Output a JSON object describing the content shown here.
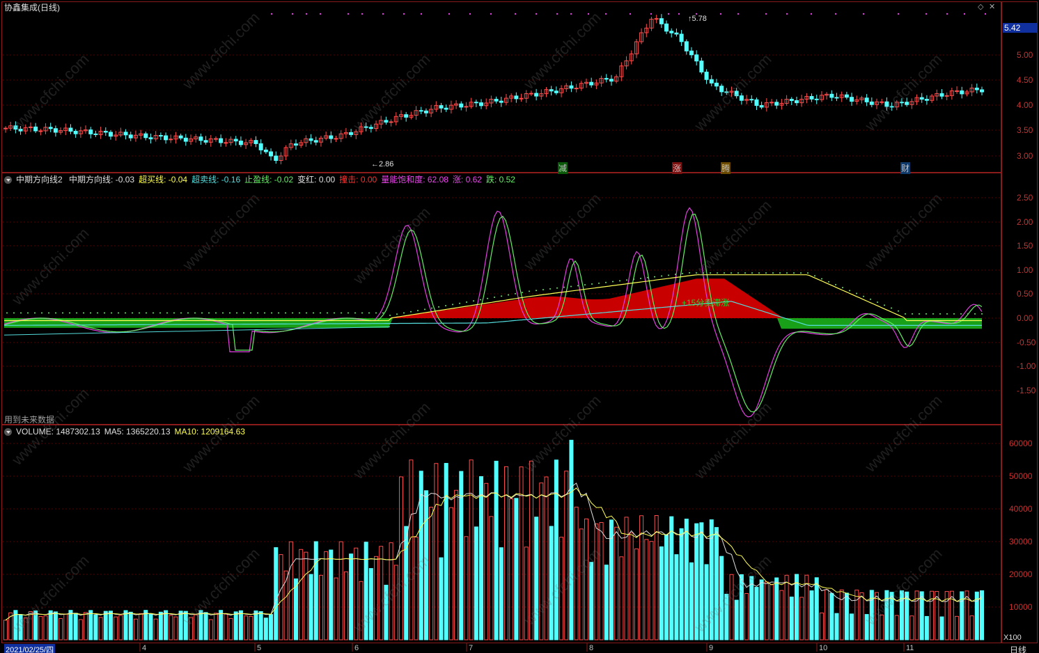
{
  "title": "协鑫集成(日线)",
  "price_axis": [
    "5.00",
    "4.50",
    "4.00",
    "3.50",
    "3.00"
  ],
  "price_current": "5.42",
  "price_high_label": "5.78",
  "price_low_label": "2.86",
  "event_chips": [
    {
      "text": "减",
      "color": "#4fe34f"
    },
    {
      "text": "涨",
      "color": "#ff6060"
    },
    {
      "text": "腾",
      "color": "#e0b020"
    },
    {
      "text": "财",
      "color": "#7fd0ff"
    }
  ],
  "indicator": {
    "name": "中期方向线2",
    "items": [
      {
        "label": "中期方向线:",
        "value": "-0.03",
        "color": "#e0e0e0"
      },
      {
        "label": "超买线:",
        "value": "-0.04",
        "color": "#ffff55"
      },
      {
        "label": "超卖线:",
        "value": "-0.16",
        "color": "#55dddd"
      },
      {
        "label": "止盈线:",
        "value": "-0.02",
        "color": "#66ee66"
      },
      {
        "label": "变红:",
        "value": "0.00",
        "color": "#e0e0e0"
      },
      {
        "label": "撞击:",
        "value": "0.00",
        "color": "#ff3030"
      },
      {
        "label": "量能饱和度:",
        "value": "62.08",
        "color": "#ee44ee"
      },
      {
        "label": "涨:",
        "value": "0.62",
        "color": "#ee44ee"
      },
      {
        "label": "跌:",
        "value": "0.52",
        "color": "#66ee66"
      }
    ],
    "axis": [
      "2.50",
      "2.00",
      "1.50",
      "1.00",
      "0.50",
      "0.00",
      "-0.50",
      "-1.00",
      "-1.50"
    ],
    "annotation": "+15分卖滞涨",
    "footer": "用到未来数据"
  },
  "volume": {
    "items": [
      {
        "label": "VOLUME:",
        "value": "1487302.13",
        "color": "#e0e0e0"
      },
      {
        "label": "MA5:",
        "value": "1365220.13",
        "color": "#e0e0e0"
      },
      {
        "label": "MA10:",
        "value": "1209164.63",
        "color": "#ffff55"
      }
    ],
    "axis": [
      "60000",
      "50000",
      "40000",
      "30000",
      "20000",
      "10000"
    ],
    "unit": "X100"
  },
  "date_axis": {
    "start": "2021/02/25/四",
    "months": [
      "4",
      "5",
      "6",
      "7",
      "8",
      "9",
      "10",
      "11"
    ],
    "period": "日线"
  },
  "watermark": "www.cfchi.com",
  "colors": {
    "up": "#ff4d4d",
    "down": "#54ffff",
    "grid": "#5a0000",
    "frame": "#8b1a1a"
  }
}
